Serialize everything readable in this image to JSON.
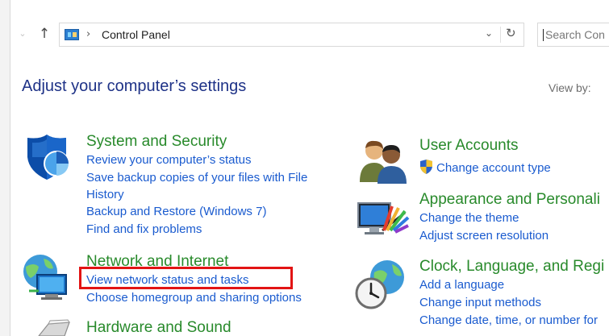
{
  "nav": {
    "back_glyph": "⌄",
    "up_glyph": "↑"
  },
  "address": {
    "separator": "›",
    "location": "Control Panel",
    "dropdown_glyph": "⌄",
    "refresh_glyph": "↻"
  },
  "search": {
    "placeholder": "Search Con"
  },
  "header": {
    "title": "Adjust your computer’s settings",
    "view_by_label": "View by:"
  },
  "categories": {
    "system_security": {
      "title": "System and Security",
      "icon": "shield-icon",
      "links": [
        "Review your computer’s status",
        "Save backup copies of your files with File History",
        "Backup and Restore (Windows 7)",
        "Find and fix problems"
      ]
    },
    "network": {
      "title": "Network and Internet",
      "icon": "globe-network-icon",
      "links": [
        "View network status and tasks",
        "Choose homegroup and sharing options"
      ]
    },
    "hardware": {
      "title": "Hardware and Sound",
      "icon": "printer-icon",
      "links": []
    },
    "user_accounts": {
      "title": "User Accounts",
      "icon": "users-icon",
      "links": [
        "Change account type"
      ]
    },
    "appearance": {
      "title": "Appearance and Personali",
      "icon": "monitor-palette-icon",
      "links": [
        "Change the theme",
        "Adjust screen resolution"
      ]
    },
    "clock": {
      "title": "Clock, Language, and Regi",
      "icon": "clock-globe-icon",
      "links": [
        "Add a language",
        "Change input methods",
        "Change date, time, or number for"
      ]
    }
  },
  "colors": {
    "category_title": "#288a2b",
    "link": "#1a5bcf",
    "heading": "#1e3287",
    "highlight_box": "#e21414"
  }
}
